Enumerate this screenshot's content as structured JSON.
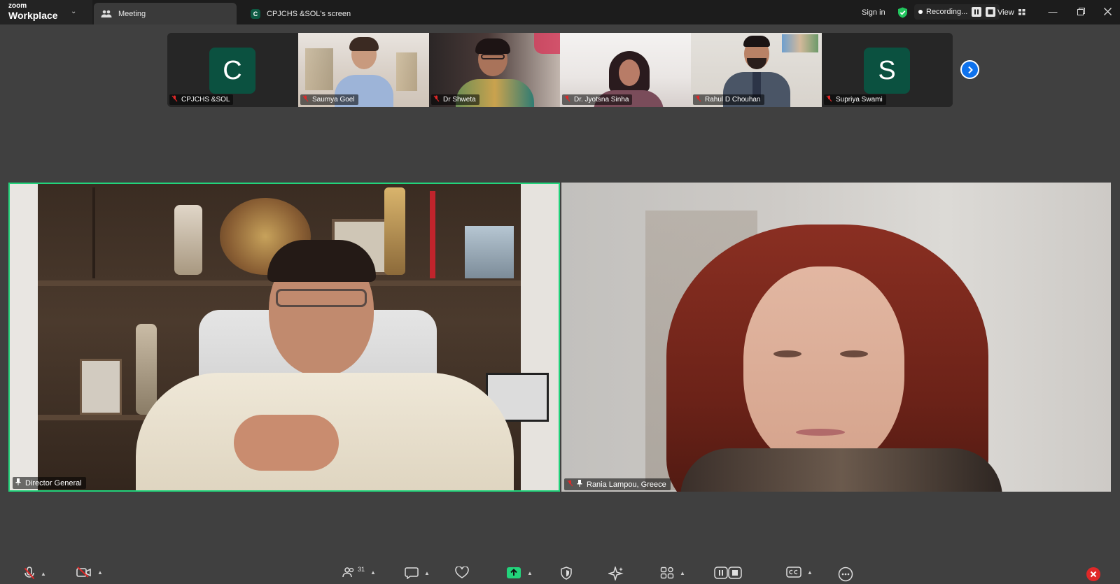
{
  "app": {
    "brand_small": "zoom",
    "brand_large": "Workplace"
  },
  "tabs": [
    {
      "label": "Meeting",
      "icon": "people-icon",
      "active": true
    },
    {
      "label": "CPJCHS &SOL's screen",
      "icon_letter": "C",
      "active": false
    }
  ],
  "titlebar": {
    "sign_in": "Sign in",
    "recording": "Recording...",
    "view": "View"
  },
  "thumbnails": [
    {
      "name": "CPJCHS &SOL",
      "avatar_letter": "C",
      "muted": true
    },
    {
      "name": "Saumya Goel",
      "muted": true
    },
    {
      "name": "Dr Shweta",
      "muted": true
    },
    {
      "name": "Dr. Jyotsna Sinha",
      "muted": true
    },
    {
      "name": "Rahul D Chouhan",
      "muted": true
    },
    {
      "name": "Supriya Swami",
      "avatar_letter": "S",
      "muted": true
    }
  ],
  "main_tiles": [
    {
      "name": "Director General",
      "pinned": true,
      "active_speaker": true
    },
    {
      "name": "Rania Lampou, Greece",
      "pinned": true,
      "muted": true
    }
  ],
  "toolbar": {
    "participants_count": "31"
  },
  "colors": {
    "accent_green": "#22d37b",
    "avatar_green": "#0b5140",
    "next_blue": "#0e72ed",
    "background": "#404040",
    "titlebar": "#1c1c1c",
    "mute_red": "#e02828",
    "share_green": "#22d37b"
  }
}
